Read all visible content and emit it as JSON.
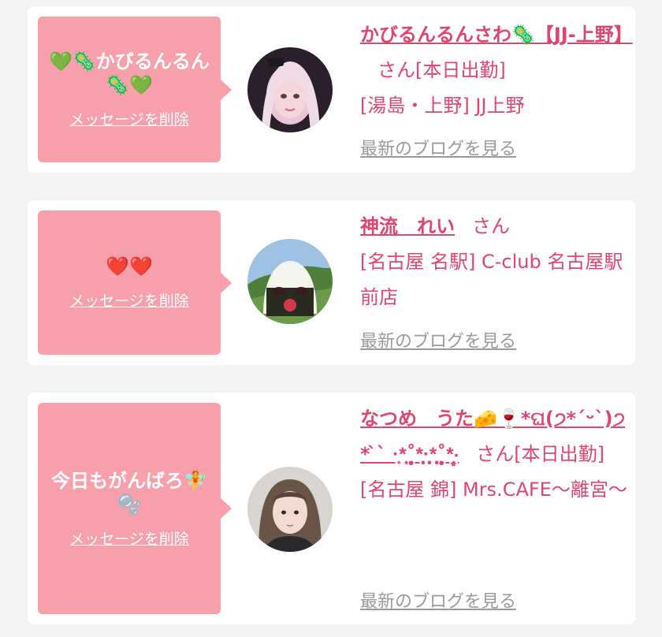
{
  "cards": [
    {
      "message": "💚🦠かびるんるん🦠💚",
      "delete_label": "メッセージを削除",
      "name": "かびるんるんさわ🦠【JJ-上野】",
      "san": "さん",
      "status": "[本日出勤]",
      "location": "[湯島・上野] JJ上野",
      "blog_label": "最新のブログを見る"
    },
    {
      "message": "❤️❤️",
      "delete_label": "メッセージを削除",
      "name": "神流　れい",
      "san": "さん",
      "status": "",
      "location": "[名古屋 名駅] C-club 名古屋駅前店",
      "blog_label": "最新のブログを見る"
    },
    {
      "message": "今日もがんばろ🧚🫧",
      "delete_label": "メッセージを削除",
      "name": "なつめ　うた🧀🍷*ଘ(੭*ˊᵕˋ)੭* ̀ˋ ·͙*̩̩͙˚̩̥̩̥*̩̩̥͙·̩̩̥͙*̩̩̥͙˚̩̥̩̥*̩̩͙‧͙",
      "san": "さん",
      "status": "[本日出勤]",
      "location": "[名古屋 錦] Mrs.CAFE～離宮～",
      "blog_label": "最新のブログを見る"
    }
  ],
  "colors": {
    "accent": "#e0456d",
    "bubble": "#f7a0ac",
    "muted": "#9a9a9a"
  }
}
